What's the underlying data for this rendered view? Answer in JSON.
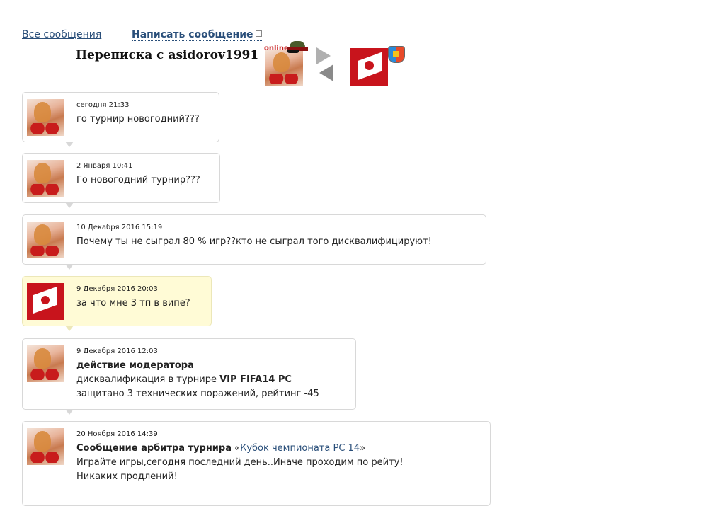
{
  "nav": {
    "all_messages": "Все сообщения",
    "write_message": "Написать сообщение"
  },
  "header": {
    "title": "Переписка с asidorov1991",
    "status": "online"
  },
  "messages": [
    {
      "date": "сегодня 21:33",
      "lines": [
        "го турнир новогодний???"
      ]
    },
    {
      "date": "2 Января 10:41",
      "lines": [
        "Го новогодний турнир???"
      ]
    },
    {
      "date": "10 Декабря 2016 15:19",
      "lines": [
        "Почему ты не сыграл 80 % игр??кто не сыграл того дисквалифицируют!"
      ]
    },
    {
      "date": "9 Декабря 2016 20:03",
      "lines": [
        "за что мне 3 тп в випе?"
      ]
    },
    {
      "date": "9 Декабря 2016 12:03",
      "heading": "действие модератора",
      "line1_prefix": "дисквалификация в турнире ",
      "line1_bold": "VIP FIFA14 PC",
      "line2": "защитано 3 технических поражений, рейтинг -45"
    },
    {
      "date": "20 Ноября 2016 14:39",
      "heading": "Сообщение арбитра турнира",
      "quote_open": "«",
      "link": "Кубок чемпионата PC 14",
      "quote_close": "»",
      "line2": "Играйте игры,сегодня последний день..Иначе проходим по рейту!",
      "line3": "Никаких продлений!"
    }
  ]
}
